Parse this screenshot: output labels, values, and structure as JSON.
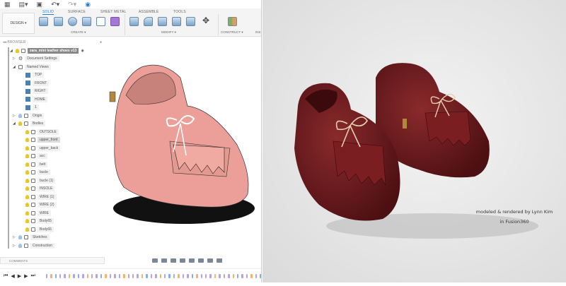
{
  "toolbar": {
    "tabs": [
      "SOLID",
      "SURFACE",
      "SHEET METAL",
      "ASSEMBLE",
      "TOOLS"
    ],
    "active_tab": "SOLID",
    "workspace": "DESIGN ▾",
    "groups": [
      "CREATE ▾",
      "MODIFY ▾",
      "CONSTRUCT ▾",
      "INS"
    ]
  },
  "browser": {
    "title": "BROWSER",
    "root": "zara_mini leather shoes v13",
    "items": [
      {
        "label": "Document Settings",
        "type": "gear",
        "level": 1,
        "expand": "▷"
      },
      {
        "label": "Named Views",
        "type": "folder",
        "level": 1,
        "expand": "◢"
      },
      {
        "label": "TOP",
        "type": "view",
        "level": 2
      },
      {
        "label": "FRONT",
        "type": "view",
        "level": 2
      },
      {
        "label": "RIGHT",
        "type": "view",
        "level": 2
      },
      {
        "label": "HOME",
        "type": "view",
        "level": 2
      },
      {
        "label": "1",
        "type": "view",
        "level": 2
      },
      {
        "label": "Origin",
        "type": "folder",
        "level": 1,
        "expand": "▷",
        "bulb": "off"
      },
      {
        "label": "Bodies",
        "type": "folder",
        "level": 1,
        "expand": "◢",
        "bulb": "on"
      },
      {
        "label": "OUTSOLE",
        "type": "body",
        "level": 2
      },
      {
        "label": "upper_front",
        "type": "body",
        "level": 2,
        "selected": true
      },
      {
        "label": "upper_back",
        "type": "body",
        "level": 2
      },
      {
        "label": "acc",
        "type": "body",
        "level": 2
      },
      {
        "label": "belt",
        "type": "body",
        "level": 2
      },
      {
        "label": "bucle",
        "type": "body",
        "level": 2
      },
      {
        "label": "bucle (1)",
        "type": "body",
        "level": 2
      },
      {
        "label": "INSOLE",
        "type": "body",
        "level": 2
      },
      {
        "label": "WIRE (1)",
        "type": "body",
        "level": 2
      },
      {
        "label": "WIRE (2)",
        "type": "body",
        "level": 2
      },
      {
        "label": "WIRE",
        "type": "body",
        "level": 2
      },
      {
        "label": "Body65",
        "type": "body",
        "level": 2
      },
      {
        "label": "Body66",
        "type": "body",
        "level": 2
      },
      {
        "label": "Sketches",
        "type": "folder",
        "level": 1,
        "expand": "▷",
        "bulb": "off"
      },
      {
        "label": "Construction",
        "type": "folder",
        "level": 1,
        "expand": "▷",
        "bulb": "off"
      }
    ]
  },
  "comments": {
    "title": "COMMENTS"
  },
  "timeline": {
    "controls": [
      "⏮",
      "◀",
      "▶",
      "▶",
      "⏭"
    ]
  },
  "render": {
    "credit_line1": "modeled & rendered by Lynn Kim",
    "credit_line2": "in Fusion360"
  },
  "colors": {
    "accent": "#1d7fd1",
    "shoe_model": "#e8a39a",
    "shoe_render": "#6e1a1c",
    "lace": "#e6cfae"
  }
}
